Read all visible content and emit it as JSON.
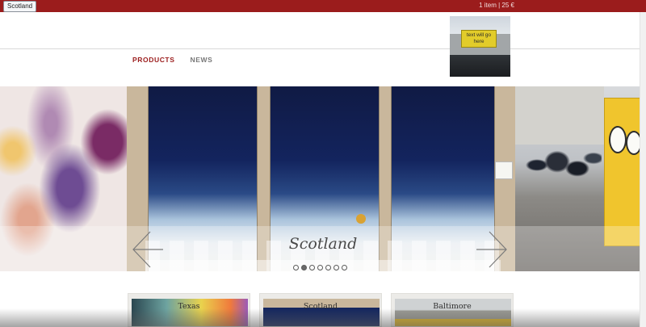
{
  "tooltip": {
    "text": "Scotland"
  },
  "topbar": {
    "cart_text": "1 item | 25 €"
  },
  "header": {
    "thumbnail_sign_text": "text will go here"
  },
  "nav": {
    "items": [
      {
        "label": "PRODUCTS",
        "active": true
      },
      {
        "label": "NEWS",
        "active": false
      }
    ]
  },
  "slider": {
    "caption": "Scotland",
    "dots_count": 7,
    "active_dot_index": 1,
    "prev_icon": "chevron-left-icon",
    "next_icon": "chevron-right-icon"
  },
  "cards": [
    {
      "label": "Texas"
    },
    {
      "label": "Scotland"
    },
    {
      "label": "Baltimore"
    }
  ],
  "colors": {
    "topbar": "#9b1c1c",
    "nav_active": "#9b1c1c",
    "nav_inactive": "#777777"
  }
}
